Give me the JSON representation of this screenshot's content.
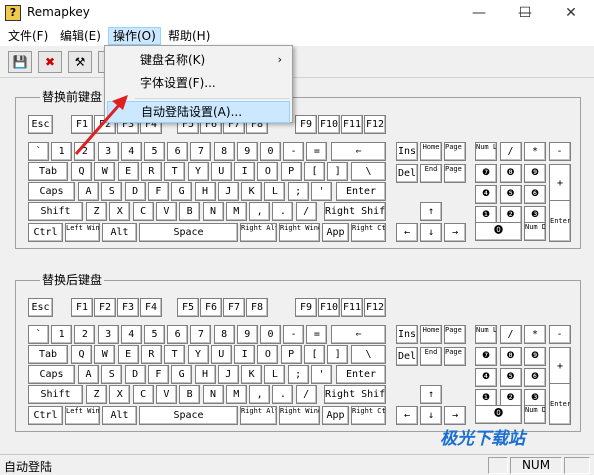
{
  "app": {
    "title": "Remapkey",
    "icon_glyph": "?"
  },
  "window_controls": {
    "minimize": "—",
    "maximize": "☐",
    "close": "✕"
  },
  "menu": {
    "file": "文件(F)",
    "edit": "编辑(E)",
    "operate": "操作(O)",
    "help": "帮助(H)"
  },
  "dropdown": {
    "items": [
      {
        "label": "键盘名称(K)",
        "submenu": true
      },
      {
        "label": "字体设置(F)..."
      },
      {
        "label": "自动登陆设置(A)..."
      }
    ],
    "submenu_arrow": "›"
  },
  "toolbar": {
    "buttons": [
      "💾",
      "✖",
      "⚒",
      ""
    ]
  },
  "keyboards": [
    {
      "label": "替换前键盘"
    },
    {
      "label": "替换后键盘"
    }
  ],
  "keys": {
    "esc": "Esc",
    "f": [
      "F1",
      "F2",
      "F3",
      "F4",
      "F5",
      "F6",
      "F7",
      "F8",
      "F9",
      "F10",
      "F11",
      "F12"
    ],
    "num_row": [
      "`",
      "1",
      "2",
      "3",
      "4",
      "5",
      "6",
      "7",
      "8",
      "9",
      "0",
      "-",
      "=",
      "⇐"
    ],
    "row_q": [
      "Tab",
      "Q",
      "W",
      "E",
      "R",
      "T",
      "Y",
      "U",
      "I",
      "O",
      "P",
      "[",
      "]",
      "\\"
    ],
    "row_a": [
      "Caps",
      "A",
      "S",
      "D",
      "F",
      "G",
      "H",
      "J",
      "K",
      "L",
      ";",
      "'",
      "Enter"
    ],
    "row_z": [
      "Shift",
      "Z",
      "X",
      "C",
      "V",
      "B",
      "N",
      "M",
      ",",
      ".",
      "/",
      "Right Shift"
    ],
    "row_ctrl": [
      "Ctrl",
      "Left Windows",
      "Alt",
      "Space",
      "Right Alt",
      "Right Windows",
      "App",
      "Right Ctrl"
    ],
    "nav_top": [
      "Ins",
      "Home",
      "Page Up"
    ],
    "nav_bottom": [
      "Del",
      "End",
      "Page Down"
    ],
    "arrows": [
      "↑",
      "←",
      "↓",
      "→"
    ],
    "numpad_top": [
      "Num Lock",
      "/",
      "*",
      "-"
    ],
    "numpad": [
      [
        "❼",
        "❽",
        "❾"
      ],
      [
        "❹",
        "❺",
        "❻"
      ],
      [
        "❶",
        "❷",
        "❸"
      ]
    ],
    "numpad_plus": "+",
    "numpad_enter": "Enter",
    "numpad_0": "⓿",
    "numpad_del": "Num Del"
  },
  "status": {
    "text": "自动登陆",
    "panel": "NUM"
  },
  "watermark": "极光下载站",
  "colors": {
    "highlight": "#cce8ff",
    "highlight_border": "#99d1ff",
    "arrow": "#e02020"
  }
}
